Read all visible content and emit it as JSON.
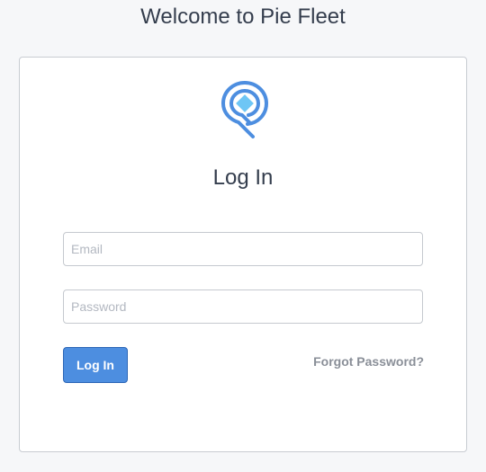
{
  "page": {
    "title": "Welcome to Pie Fleet"
  },
  "login": {
    "heading": "Log In",
    "email": {
      "value": "",
      "placeholder": "Email"
    },
    "password": {
      "value": "",
      "placeholder": "Password"
    },
    "submit_label": "Log In",
    "forgot_label": "Forgot Password?"
  },
  "colors": {
    "background": "#f6f7f9",
    "card": "#ffffff",
    "accent": "#4d8ee0",
    "logo_accent": "#6ec6f5",
    "text": "#343d4d",
    "muted": "#8a8f98"
  },
  "icons": {
    "logo": "pie-fleet-logo-icon"
  }
}
